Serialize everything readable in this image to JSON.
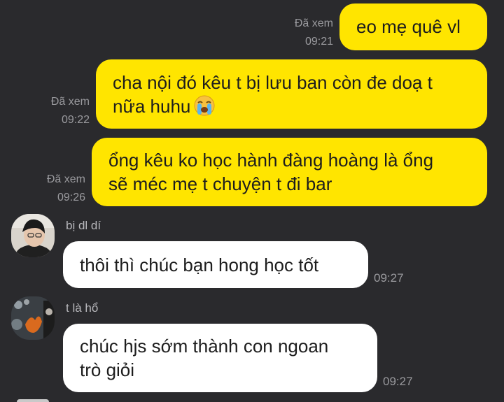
{
  "messages": [
    {
      "type": "outgoing",
      "text": "eo mẹ quê vl",
      "status": "Đã xem",
      "time": "09:21"
    },
    {
      "type": "outgoing",
      "line1": "cha nội đó kêu t bị lưu ban còn đe doạ t",
      "line2": "nữa huhu",
      "emoji": "loudly-crying-face",
      "status": "Đã xem",
      "time": "09:22"
    },
    {
      "type": "outgoing",
      "line1": "ổng kêu ko học hành đàng hoàng là ổng",
      "line2": "sẽ méc mẹ t chuyện t đi bar",
      "status": "Đã xem",
      "time": "09:26"
    },
    {
      "type": "incoming",
      "sender": "bị dl dí",
      "text": "thôi thì chúc bạn hong học tốt",
      "time": "09:27"
    },
    {
      "type": "incoming",
      "sender": "t là hổ",
      "line1": "chúc hjs sớm thành con ngoan",
      "line2": "trò giỏi",
      "time": "09:27"
    }
  ]
}
